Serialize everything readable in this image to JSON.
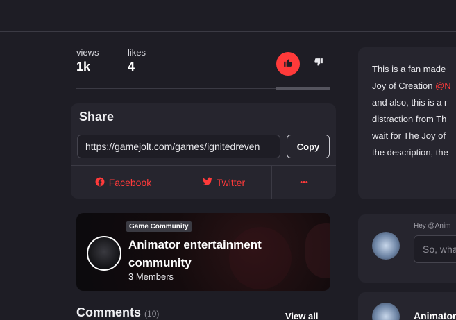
{
  "stats": {
    "views_label": "views",
    "views_value": "1k",
    "likes_label": "likes",
    "likes_value": "4"
  },
  "share": {
    "title": "Share",
    "url": "https://gamejolt.com/games/ignitedreven",
    "copy_label": "Copy",
    "facebook_label": "Facebook",
    "twitter_label": "Twitter",
    "more_label": "•••"
  },
  "community": {
    "tag": "Game Community",
    "name": "Animator entertainment community",
    "members": "3 Members"
  },
  "comments": {
    "title": "Comments",
    "count": "(10)",
    "view_all": "View all"
  },
  "description": {
    "line1": "This is a fan made",
    "line2_prefix": "Joy of Creation ",
    "line2_mention": "@N",
    "line3": "and also, this is a r",
    "line4": "distraction from Th",
    "line5": "wait for The Joy of",
    "line6": "the description, the"
  },
  "comment_box": {
    "hey": "Hey @Anim",
    "placeholder": "So, wha"
  },
  "comment2": {
    "author": "Animator"
  },
  "colors": {
    "background": "#1e1d25",
    "card": "#26252e",
    "accent": "#ff3a3a"
  }
}
